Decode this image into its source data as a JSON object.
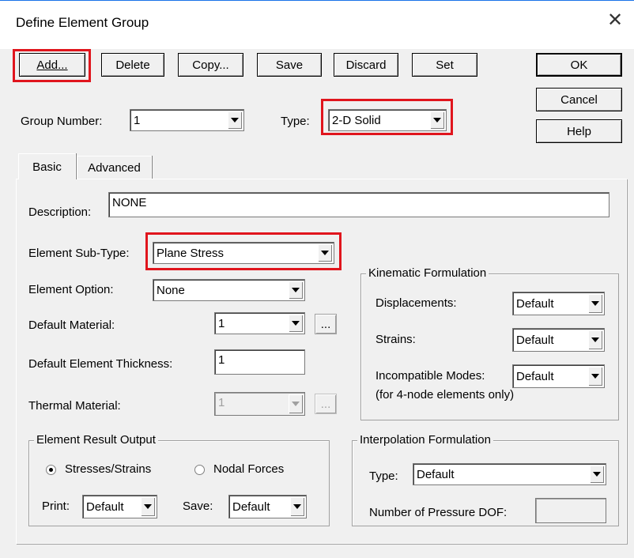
{
  "window": {
    "title": "Define Element Group",
    "close_glyph": "✕"
  },
  "toolbar": {
    "add": "Add...",
    "delete": "Delete",
    "copy": "Copy...",
    "save": "Save",
    "discard": "Discard",
    "set": "Set",
    "ok": "OK",
    "cancel": "Cancel",
    "help": "Help"
  },
  "group_number": {
    "label": "Group Number:",
    "value": "1"
  },
  "type": {
    "label": "Type:",
    "value": "2-D Solid"
  },
  "tabs": [
    {
      "label": "Basic"
    },
    {
      "label": "Advanced"
    }
  ],
  "basic": {
    "description": {
      "label": "Description:",
      "value": "NONE"
    },
    "element_sub_type": {
      "label": "Element Sub-Type:",
      "value": "Plane Stress"
    },
    "element_option": {
      "label": "Element Option:",
      "value": "None"
    },
    "default_material": {
      "label": "Default Material:",
      "value": "1",
      "browse": "..."
    },
    "default_thickness": {
      "label": "Default Element Thickness:",
      "value": "1"
    },
    "thermal_material": {
      "label": "Thermal Material:",
      "value": "1",
      "browse": "..."
    }
  },
  "kinematic": {
    "title": "Kinematic Formulation",
    "displacements": {
      "label": "Displacements:",
      "value": "Default"
    },
    "strains": {
      "label": "Strains:",
      "value": "Default"
    },
    "incompatible": {
      "label": "Incompatible Modes:",
      "value": "Default"
    },
    "note": "(for 4-node elements only)"
  },
  "result_output": {
    "title": "Element Result Output",
    "radio_stresses": "Stresses/Strains",
    "radio_nodal": "Nodal Forces",
    "selected": "Stresses/Strains",
    "print": {
      "label": "Print:",
      "value": "Default"
    },
    "save": {
      "label": "Save:",
      "value": "Default"
    }
  },
  "interpolation": {
    "title": "Interpolation Formulation",
    "type": {
      "label": "Type:",
      "value": "Default"
    },
    "pressure_dof": {
      "label": "Number of Pressure DOF:",
      "value": ""
    }
  },
  "highlight_color": "#e0151d"
}
